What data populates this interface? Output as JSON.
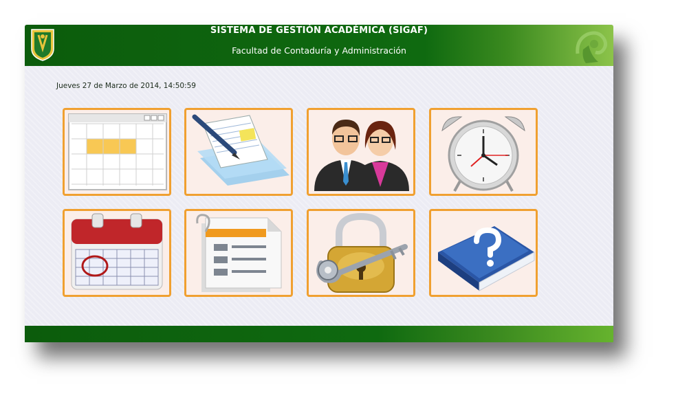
{
  "header": {
    "title": "SISTEMA DE GESTIÓN ACADÉMICA (SIGAF)",
    "subtitle": "Facultad de Contaduría y Administración"
  },
  "datetime": "Jueves 27 de Marzo de 2014, 14:50:59",
  "tiles": [
    {
      "icon": "schedule-grid-icon"
    },
    {
      "icon": "documents-pen-icon"
    },
    {
      "icon": "users-icon"
    },
    {
      "icon": "alarm-clock-icon"
    },
    {
      "icon": "calendar-icon"
    },
    {
      "icon": "report-document-icon"
    },
    {
      "icon": "padlock-key-icon"
    },
    {
      "icon": "help-book-icon"
    }
  ],
  "colors": {
    "header_green": "#0f6a10",
    "tile_border": "#f0a030",
    "tile_bg": "#fbeee9",
    "page_bg": "#ececf4"
  }
}
